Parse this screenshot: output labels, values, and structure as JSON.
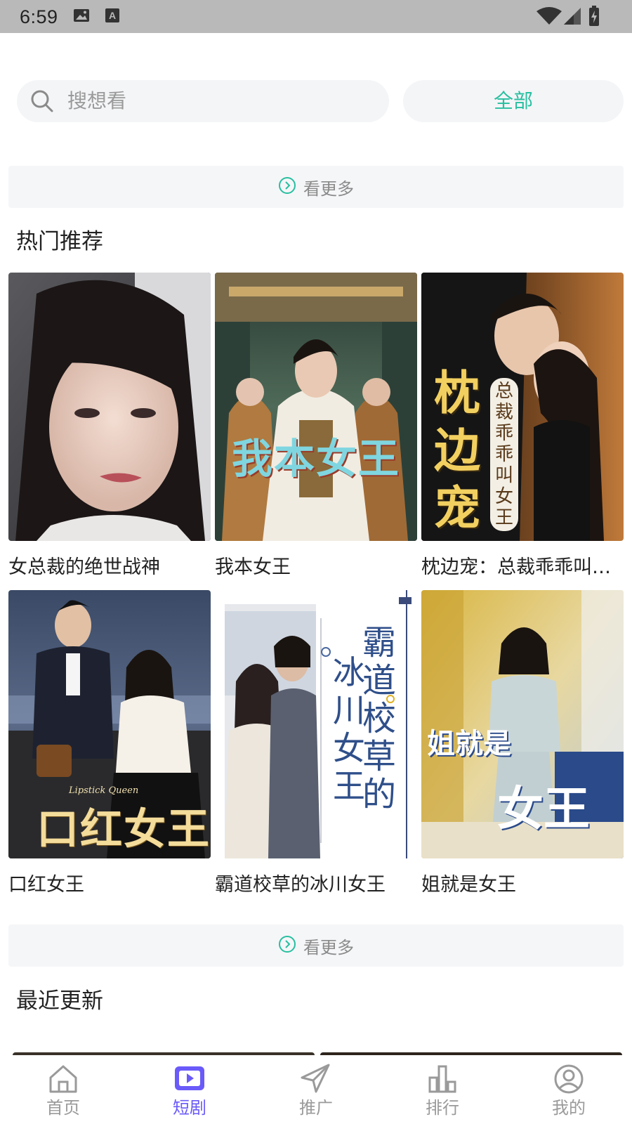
{
  "status_bar": {
    "time": "6:59"
  },
  "search": {
    "placeholder": "搜想看",
    "filter_label": "全部"
  },
  "see_more_label": "看更多",
  "hot": {
    "title": "热门推荐",
    "items": [
      {
        "title": "女总裁的绝世战神"
      },
      {
        "title": "我本女王",
        "poster_text": "我本女王"
      },
      {
        "title": "枕边宠：总裁乖乖叫女王",
        "poster_text_main": "枕边宠",
        "poster_text_side": "总裁乖乖叫女王"
      },
      {
        "title": "口红女王",
        "poster_text": "口红女王",
        "poster_subtext": "Lipstick Queen"
      },
      {
        "title": "霸道校草的冰川女王",
        "poster_text_a": "霸道校草的",
        "poster_text_b": "冰川女王"
      },
      {
        "title": "姐就是女王",
        "poster_text_a": "姐就是",
        "poster_text_b": "女王"
      }
    ]
  },
  "recent": {
    "title": "最近更新"
  },
  "bottom_nav": {
    "items": [
      {
        "label": "首页",
        "icon": "home-icon"
      },
      {
        "label": "短剧",
        "icon": "play-icon",
        "active": true
      },
      {
        "label": "推广",
        "icon": "paper-plane-icon"
      },
      {
        "label": "排行",
        "icon": "bar-chart-icon"
      },
      {
        "label": "我的",
        "icon": "user-icon"
      }
    ]
  },
  "colors": {
    "accent": "#27bfa0",
    "nav_active": "#6a5af9",
    "status_bar": "#b9b9b9"
  }
}
